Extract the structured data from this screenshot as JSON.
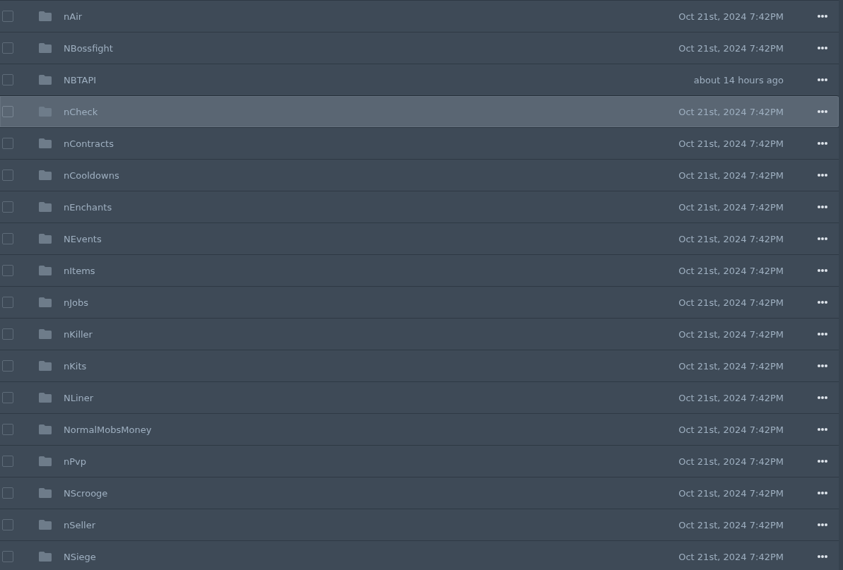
{
  "rows": [
    {
      "name": "nAir",
      "modified": "Oct 21st, 2024 7:42PM",
      "checked": false,
      "selected": false
    },
    {
      "name": "NBossfight",
      "modified": "Oct 21st, 2024 7:42PM",
      "checked": false,
      "selected": false
    },
    {
      "name": "NBTAPI",
      "modified": "about 14 hours ago",
      "checked": false,
      "selected": false
    },
    {
      "name": "nCheck",
      "modified": "Oct 21st, 2024 7:42PM",
      "checked": false,
      "selected": true
    },
    {
      "name": "nContracts",
      "modified": "Oct 21st, 2024 7:42PM",
      "checked": false,
      "selected": false
    },
    {
      "name": "nCooldowns",
      "modified": "Oct 21st, 2024 7:42PM",
      "checked": false,
      "selected": false
    },
    {
      "name": "nEnchants",
      "modified": "Oct 21st, 2024 7:42PM",
      "checked": false,
      "selected": false
    },
    {
      "name": "NEvents",
      "modified": "Oct 21st, 2024 7:42PM",
      "checked": false,
      "selected": false
    },
    {
      "name": "nItems",
      "modified": "Oct 21st, 2024 7:42PM",
      "checked": false,
      "selected": false
    },
    {
      "name": "nJobs",
      "modified": "Oct 21st, 2024 7:42PM",
      "checked": false,
      "selected": false
    },
    {
      "name": "nKiller",
      "modified": "Oct 21st, 2024 7:42PM",
      "checked": false,
      "selected": false
    },
    {
      "name": "nKits",
      "modified": "Oct 21st, 2024 7:42PM",
      "checked": false,
      "selected": false
    },
    {
      "name": "NLiner",
      "modified": "Oct 21st, 2024 7:42PM",
      "checked": false,
      "selected": false
    },
    {
      "name": "NormalMobsMoney",
      "modified": "Oct 21st, 2024 7:42PM",
      "checked": false,
      "selected": false
    },
    {
      "name": "nPvp",
      "modified": "Oct 21st, 2024 7:42PM",
      "checked": false,
      "selected": false
    },
    {
      "name": "NScrooge",
      "modified": "Oct 21st, 2024 7:42PM",
      "checked": false,
      "selected": false
    },
    {
      "name": "nSeller",
      "modified": "Oct 21st, 2024 7:42PM",
      "checked": false,
      "selected": false
    },
    {
      "name": "NSiege",
      "modified": "Oct 21st, 2024 7:42PM",
      "checked": false,
      "selected": false
    }
  ]
}
